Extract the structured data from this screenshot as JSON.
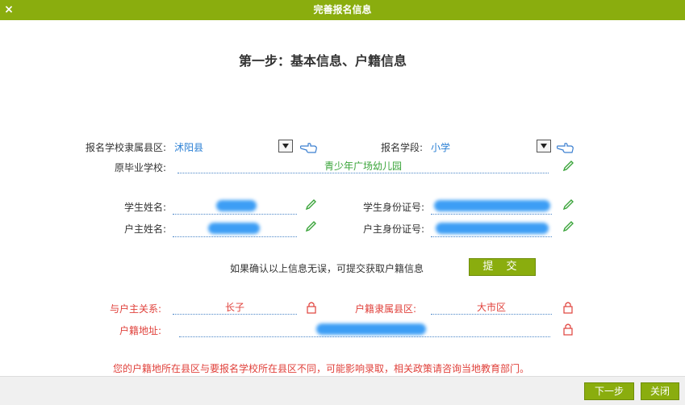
{
  "window": {
    "title": "完善报名信息",
    "close_glyph": "×"
  },
  "heading": "第一步：基本信息、户籍信息",
  "form": {
    "district_label": "报名学校隶属县区:",
    "district_value": "沭阳县",
    "segment_label": "报名学段:",
    "segment_value": "小学",
    "grad_school_label": "原毕业学校:",
    "grad_school_value": "青少年广场幼儿园",
    "student_name_label": "学生姓名:",
    "student_id_label": "学生身份证号:",
    "householder_name_label": "户主姓名:",
    "householder_id_label": "户主身份证号:"
  },
  "confirm_note": "如果确认以上信息无误，可提交获取户籍信息",
  "submit_label": "提 交",
  "household": {
    "relation_label": "与户主关系:",
    "relation_value": "长子",
    "district_label": "户籍隶属县区:",
    "district_value": "大市区",
    "address_label": "户籍地址:"
  },
  "notice": "您的户籍地所在县区与要报名学校所在县区不同，可能影响录取，相关政策请咨询当地教育部门。",
  "footer": {
    "next_label": "下一步",
    "close_label": "关闭"
  },
  "icons": {
    "edit": "pencil-icon",
    "lock": "lock-icon",
    "hand": "pointing-hand-icon"
  },
  "colors": {
    "accent": "#8aad0e",
    "blue_text": "#2a7fd4",
    "green_text": "#3aa43a",
    "red_text": "#e0413b"
  }
}
